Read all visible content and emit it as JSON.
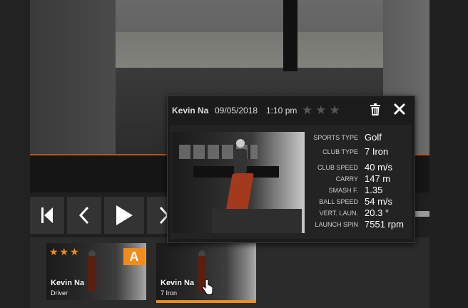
{
  "popup": {
    "player": "Kevin Na",
    "date": "09/05/2018",
    "time": "1:10 pm",
    "rating_stars": "★★★",
    "stats": [
      {
        "label": "SPORTS TYPE",
        "value": "Golf"
      },
      {
        "label": "CLUB TYPE",
        "value": "7 Iron"
      },
      {
        "label": "CLUB SPEED",
        "value": "40 m/s"
      },
      {
        "label": "CARRY",
        "value": "147 m"
      },
      {
        "label": "SMASH F.",
        "value": "1.35"
      },
      {
        "label": "BALL SPEED",
        "value": "54 m/s"
      },
      {
        "label": "VERT. LAUN.",
        "value": "20.3 °"
      },
      {
        "label": "LAUNCH SPIN",
        "value": "7551 rpm"
      }
    ]
  },
  "controls": {
    "icons": [
      "skip-start-icon",
      "previous-icon",
      "play-icon",
      "next-icon"
    ]
  },
  "thumbnails": [
    {
      "player": "Kevin Na",
      "club": "Driver",
      "stars": "★★★",
      "badge": "A"
    },
    {
      "player": "Kevin Na",
      "club": "7 Iron"
    }
  ],
  "colors": {
    "accent": "#f08c1c",
    "background": "#1f1f1f",
    "popup_bg": "#1b1b1b"
  }
}
